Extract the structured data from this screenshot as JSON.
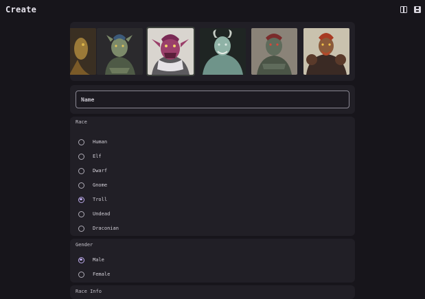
{
  "header": {
    "title": "Create",
    "icons": [
      "columns-icon",
      "save-icon"
    ]
  },
  "portraits": [
    {
      "name": "portrait-lizard",
      "colors": {
        "bg": "#3a2f22",
        "skin": "#9b7a38",
        "hair": "#5a3f1e"
      }
    },
    {
      "name": "portrait-green-orc",
      "colors": {
        "bg": "#2b2a2d",
        "skin": "#7c8a6a",
        "hair": "#3c5a7a"
      }
    },
    {
      "name": "portrait-purple-troll",
      "colors": {
        "bg": "#d9d5cf",
        "skin": "#9a3f6a",
        "hair": "#7a2a55"
      }
    },
    {
      "name": "portrait-blue-troll",
      "colors": {
        "bg": "#1f2523",
        "skin": "#8fb2a6",
        "hair": "#c8cfc7"
      }
    },
    {
      "name": "portrait-grey-orc",
      "colors": {
        "bg": "#8a8378",
        "skin": "#5f6b5b",
        "hair": "#7a2b2b"
      }
    },
    {
      "name": "portrait-red-orc",
      "colors": {
        "bg": "#c9c2ae",
        "skin": "#8a5a3a",
        "hair": "#a83a22"
      }
    }
  ],
  "name_field": {
    "placeholder": "Name",
    "value": ""
  },
  "race": {
    "label": "Race",
    "selected": "Troll",
    "options": [
      "Human",
      "Elf",
      "Dwarf",
      "Gnome",
      "Troll",
      "Undead",
      "Draconian"
    ]
  },
  "gender": {
    "label": "Gender",
    "selected": "Male",
    "options": [
      "Male",
      "Female"
    ]
  },
  "race_info": {
    "label": "Race Info"
  },
  "colors": {
    "background": "#17151b",
    "panel": "#211f26",
    "accent": "#b9a8e8"
  }
}
